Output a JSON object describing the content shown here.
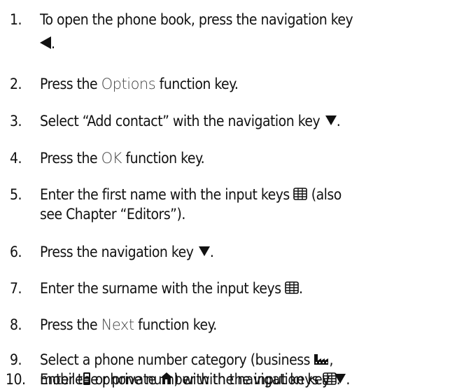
{
  "steps": [
    {
      "number": "1.",
      "line1": "To open the phone book, press the navigation key",
      "line2_end": "."
    },
    {
      "number": "2.",
      "pre": "Press the ",
      "function_key": "Options",
      "post": " function key."
    },
    {
      "number": "3.",
      "text": "Select “Add contact” with the navigation key ",
      "post": "."
    },
    {
      "number": "4.",
      "pre": "Press the ",
      "function_key": "OK",
      "post": " function key."
    },
    {
      "number": "5.",
      "line1_pre": "Enter the first name with the input keys ",
      "line1_post": " (also",
      "line2": "see Chapter “Editors”)."
    },
    {
      "number": "6.",
      "text": "Press the navigation key ",
      "post": "."
    },
    {
      "number": "7.",
      "text": "Enter the surname with the input keys ",
      "post": "."
    },
    {
      "number": "8.",
      "pre": "Press the ",
      "function_key": "Next",
      "post": " function key."
    },
    {
      "number": "9.",
      "line1_pre": "Select a phone number category (business ",
      "line1_post": ",",
      "line2_pre": "mobile",
      "line2_mid": " or private ",
      "line2_mid2": ") with the navigation key ",
      "line2_post": "."
    },
    {
      "number": "10.",
      "text": "Enter the phone number with the input keys ",
      "post": "."
    }
  ],
  "icons": {
    "navigation_left": "navigation-left-icon",
    "navigation_down": "navigation-down-icon",
    "input_keys": "keypad-icon",
    "business": "business-factory-icon",
    "mobile": "mobile-handset-icon",
    "private": "private-home-icon"
  }
}
